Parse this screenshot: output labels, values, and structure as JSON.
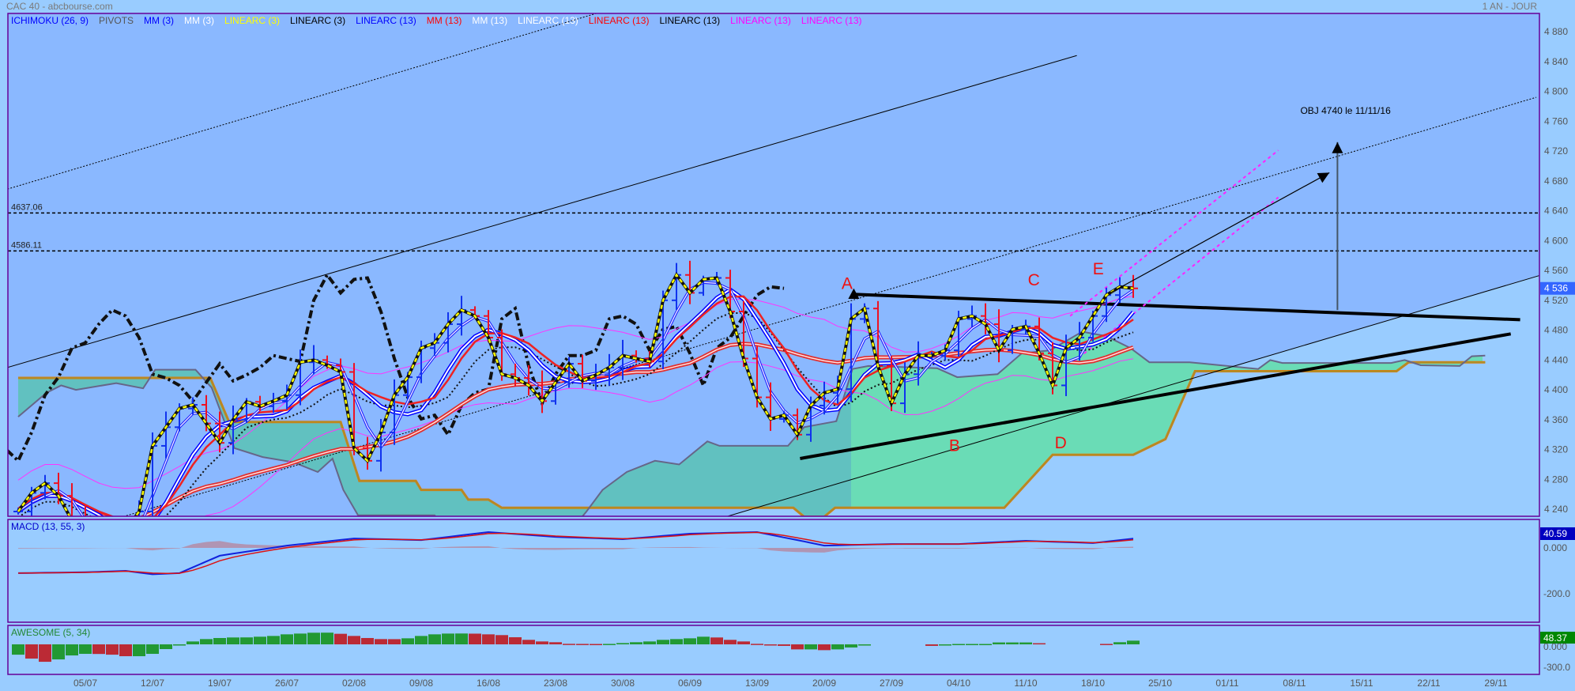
{
  "header": {
    "title": "CAC 40 - abcbourse.com",
    "period": "1 AN - JOUR"
  },
  "legend": [
    {
      "label": "ICHIMOKU (26, 9)",
      "color": "#0000ff"
    },
    {
      "label": "PIVOTS",
      "color": "#555555"
    },
    {
      "label": "MM (3)",
      "color": "#0000ff"
    },
    {
      "label": "MM (3)",
      "color": "#ffffff"
    },
    {
      "label": "LINEARC (3)",
      "color": "#ffff00"
    },
    {
      "label": "LINEARC (3)",
      "color": "#000000"
    },
    {
      "label": "LINEARC (13)",
      "color": "#0000ff"
    },
    {
      "label": "MM (13)",
      "color": "#ff0000"
    },
    {
      "label": "MM (13)",
      "color": "#ffffff"
    },
    {
      "label": "LINEARC (13)",
      "color": "#ffffff"
    },
    {
      "label": "LINEARC (13)",
      "color": "#ff0000"
    },
    {
      "label": "LINEARC (13)",
      "color": "#000000"
    },
    {
      "label": "LINEARC (13)",
      "color": "#ff00ff"
    },
    {
      "label": "LINEARC (13)",
      "color": "#ff00ff"
    }
  ],
  "chart_data": {
    "type": "line",
    "title": "CAC 40",
    "price_axis": {
      "min": 4240,
      "max": 4880,
      "step": 40,
      "tick_labels": [
        "4 240",
        "4 280",
        "4 320",
        "4 360",
        "4 400",
        "4 440",
        "4 480",
        "4 520",
        "4 560",
        "4 600",
        "4 640",
        "4 680",
        "4 720",
        "4 760",
        "4 800",
        "4 840",
        "4 880"
      ]
    },
    "last_price": {
      "value": 4536,
      "label": "4 536"
    },
    "x_ticks": [
      {
        "label": "05/07",
        "day": 0
      },
      {
        "label": "12/07",
        "day": 5
      },
      {
        "label": "19/07",
        "day": 10
      },
      {
        "label": "26/07",
        "day": 15
      },
      {
        "label": "02/08",
        "day": 20
      },
      {
        "label": "09/08",
        "day": 25
      },
      {
        "label": "16/08",
        "day": 30
      },
      {
        "label": "23/08",
        "day": 35
      },
      {
        "label": "30/08",
        "day": 40
      },
      {
        "label": "06/09",
        "day": 45
      },
      {
        "label": "13/09",
        "day": 50
      },
      {
        "label": "20/09",
        "day": 55
      },
      {
        "label": "27/09",
        "day": 60
      },
      {
        "label": "04/10",
        "day": 65
      },
      {
        "label": "11/10",
        "day": 70
      },
      {
        "label": "18/10",
        "day": 75
      },
      {
        "label": "25/10",
        "day": 80
      },
      {
        "label": "01/11",
        "day": 85
      },
      {
        "label": "08/11",
        "day": 90
      },
      {
        "label": "15/11",
        "day": 95
      },
      {
        "label": "22/11",
        "day": 100
      },
      {
        "label": "29/11",
        "day": 105
      }
    ],
    "first_day": -5,
    "closes": [
      4237,
      4262,
      4275,
      4258,
      4225,
      4195,
      4180,
      4190,
      4212,
      4237,
      4325,
      4350,
      4375,
      4380,
      4355,
      4329,
      4360,
      4384,
      4378,
      4385,
      4393,
      4437,
      4440,
      4433,
      4424,
      4322,
      4305,
      4343,
      4393,
      4417,
      4456,
      4463,
      4488,
      4507,
      4499,
      4470,
      4421,
      4416,
      4406,
      4385,
      4410,
      4435,
      4412,
      4420,
      4430,
      4446,
      4442,
      4438,
      4520,
      4554,
      4530,
      4548,
      4550,
      4505,
      4442,
      4390,
      4361,
      4366,
      4340,
      4379,
      4396,
      4401,
      4495,
      4509,
      4432,
      4382,
      4421,
      4446,
      4446,
      4453,
      4495,
      4499,
      4488,
      4453,
      4481,
      4485,
      4449,
      4406,
      4456,
      4470,
      4499,
      4527,
      4538,
      4536
    ],
    "ichimoku": {
      "senkou_a": [
        [
          -5,
          4364
        ],
        [
          -2.9,
          4396
        ],
        [
          -1.8,
          4406
        ],
        [
          -0.7,
          4400
        ],
        [
          2.3,
          4409
        ],
        [
          4.3,
          4402
        ],
        [
          5.2,
          4427
        ],
        [
          8.2,
          4427
        ],
        [
          9.4,
          4403
        ],
        [
          11.1,
          4322
        ],
        [
          13.2,
          4310
        ],
        [
          15.5,
          4303
        ],
        [
          17.3,
          4290
        ],
        [
          18.4,
          4308
        ],
        [
          19.2,
          4266
        ],
        [
          20.3,
          4232
        ],
        [
          26,
          4232
        ],
        [
          27,
          4200
        ],
        [
          35.6,
          4200
        ],
        [
          37.3,
          4237
        ],
        [
          38.5,
          4266
        ],
        [
          40.3,
          4290
        ],
        [
          42.4,
          4305
        ],
        [
          44.2,
          4300
        ],
        [
          46.3,
          4331
        ],
        [
          47.2,
          4325
        ],
        [
          52.3,
          4325
        ],
        [
          53.5,
          4350
        ],
        [
          55.9,
          4358
        ],
        [
          57.1,
          4428
        ],
        [
          58.3,
          4432
        ],
        [
          63.4,
          4429
        ],
        [
          64.9,
          4417
        ],
        [
          67.9,
          4421
        ],
        [
          69.7,
          4449
        ],
        [
          71.8,
          4453
        ],
        [
          74.2,
          4478
        ],
        [
          76,
          4472
        ],
        [
          77.8,
          4456
        ],
        [
          79.2,
          4437
        ],
        [
          82.2,
          4437
        ],
        [
          87.3,
          4428
        ],
        [
          88.2,
          4440
        ],
        [
          89.1,
          4436
        ],
        [
          97.2,
          4436
        ],
        [
          98.2,
          4440
        ],
        [
          99.4,
          4433
        ],
        [
          102.3,
          4432
        ],
        [
          103.2,
          4445
        ],
        [
          104.2,
          4446
        ]
      ],
      "senkou_b": [
        [
          -5,
          4416
        ],
        [
          9.3,
          4416
        ],
        [
          10.7,
          4357
        ],
        [
          19,
          4357
        ],
        [
          20.4,
          4278
        ],
        [
          24.6,
          4278
        ],
        [
          25,
          4266
        ],
        [
          28,
          4266
        ],
        [
          28.5,
          4253
        ],
        [
          30,
          4253
        ],
        [
          31,
          4242
        ],
        [
          52.7,
          4242
        ],
        [
          53.5,
          4230
        ],
        [
          55,
          4230
        ],
        [
          55.8,
          4242
        ],
        [
          68.4,
          4242
        ],
        [
          72,
          4313
        ],
        [
          78,
          4313
        ],
        [
          80.4,
          4334
        ],
        [
          82.6,
          4425
        ],
        [
          97.6,
          4425
        ],
        [
          98.5,
          4437
        ],
        [
          104.2,
          4437
        ]
      ]
    },
    "pivots": [
      {
        "value": 4637.06,
        "label": "4637.06"
      },
      {
        "value": 4586.11,
        "label": "4586.11"
      }
    ],
    "trendlines": [
      {
        "name": "upper-channel-line",
        "from": [
          -5.8,
          4430
        ],
        "to": [
          73.8,
          4848
        ],
        "style": "thin"
      },
      {
        "name": "top-dotted-line",
        "from": [
          -5.8,
          4669
        ],
        "to": [
          40,
          4915
        ],
        "style": "dotted"
      },
      {
        "name": "mid-dotted-line",
        "from": [
          2.6,
          4229
        ],
        "to": [
          108,
          4792
        ],
        "style": "dotted"
      },
      {
        "name": "lower-channel-line",
        "from": [
          47.5,
          4229
        ],
        "to": [
          108.2,
          4553
        ],
        "style": "thin"
      },
      {
        "name": "triangle-upper-line",
        "from": [
          57.2,
          4528
        ],
        "to": [
          106.8,
          4494
        ],
        "style": "thick"
      },
      {
        "name": "triangle-lower-line",
        "from": [
          53.2,
          4308
        ],
        "to": [
          106.1,
          4475
        ],
        "style": "thick"
      },
      {
        "name": "projection-line-upper",
        "from": [
          73.3,
          4499
        ],
        "to": [
          88.8,
          4721
        ],
        "style": "magenta"
      },
      {
        "name": "projection-line-lower",
        "from": [
          73.6,
          4438
        ],
        "to": [
          88.8,
          4658
        ],
        "style": "magenta"
      }
    ],
    "arrows": [
      {
        "name": "breakout-arrow",
        "from": [
          76.3,
          4530
        ],
        "to": [
          92.6,
          4691
        ]
      },
      {
        "name": "target-arrow",
        "from": [
          93.2,
          4507
        ],
        "to": [
          93.2,
          4732
        ]
      }
    ],
    "annotations": [
      {
        "text": "A",
        "at": [
          56.7,
          4535
        ],
        "color": "#ee1111"
      },
      {
        "text": "B",
        "at": [
          64.7,
          4318
        ],
        "color": "#ee1111"
      },
      {
        "text": "C",
        "at": [
          70.6,
          4540
        ],
        "color": "#ee1111"
      },
      {
        "text": "D",
        "at": [
          72.6,
          4322
        ],
        "color": "#ee1111"
      },
      {
        "text": "E",
        "at": [
          75.4,
          4555
        ],
        "color": "#ee1111"
      },
      {
        "text": "OBJ 4740 le 11/11/16",
        "at": [
          93.8,
          4770
        ],
        "color": "#000000"
      }
    ],
    "macd": {
      "title": "MACD (13, 55, 3)",
      "last_label": "40.59",
      "tick_labels": {
        "zero": "0.000",
        "low": "-200.0"
      },
      "range": [
        -250,
        100
      ],
      "points": [
        [
          -5,
          -110
        ],
        [
          0,
          -106
        ],
        [
          3,
          -100
        ],
        [
          5,
          -115
        ],
        [
          7,
          -110
        ],
        [
          10,
          -34
        ],
        [
          15,
          10
        ],
        [
          20,
          41
        ],
        [
          25,
          34
        ],
        [
          30,
          69
        ],
        [
          35,
          48
        ],
        [
          40,
          38
        ],
        [
          45,
          62
        ],
        [
          50,
          69
        ],
        [
          53,
          34
        ],
        [
          55,
          10
        ],
        [
          60,
          17
        ],
        [
          65,
          17
        ],
        [
          70,
          31
        ],
        [
          75,
          21
        ],
        [
          78,
          40.59
        ]
      ]
    },
    "awesome": {
      "title": "AWESOME (5, 34)",
      "last_label": "48.37",
      "tick_labels": {
        "zero": "0.000",
        "low": "-300.0"
      },
      "values": [
        -135,
        -186,
        -228,
        -197,
        -145,
        -124,
        -126,
        -135,
        -155,
        -155,
        -124,
        -62,
        -10,
        38,
        69,
        83,
        90,
        91,
        100,
        110,
        131,
        141,
        152,
        153,
        138,
        110,
        83,
        69,
        68,
        79,
        110,
        131,
        141,
        142,
        140,
        131,
        121,
        93,
        59,
        38,
        28,
        7,
        6,
        5,
        6,
        17,
        28,
        38,
        59,
        69,
        79,
        100,
        90,
        59,
        38,
        7,
        -15,
        -20,
        -66,
        -66,
        -76,
        -66,
        -41,
        -8,
        null,
        null,
        null,
        null,
        -20,
        -8,
        5,
        5,
        5,
        25,
        25,
        25,
        15,
        null,
        null,
        null,
        null,
        6,
        28,
        48.37
      ],
      "up_color": "#229933",
      "down_color": "#bb2a35"
    }
  }
}
